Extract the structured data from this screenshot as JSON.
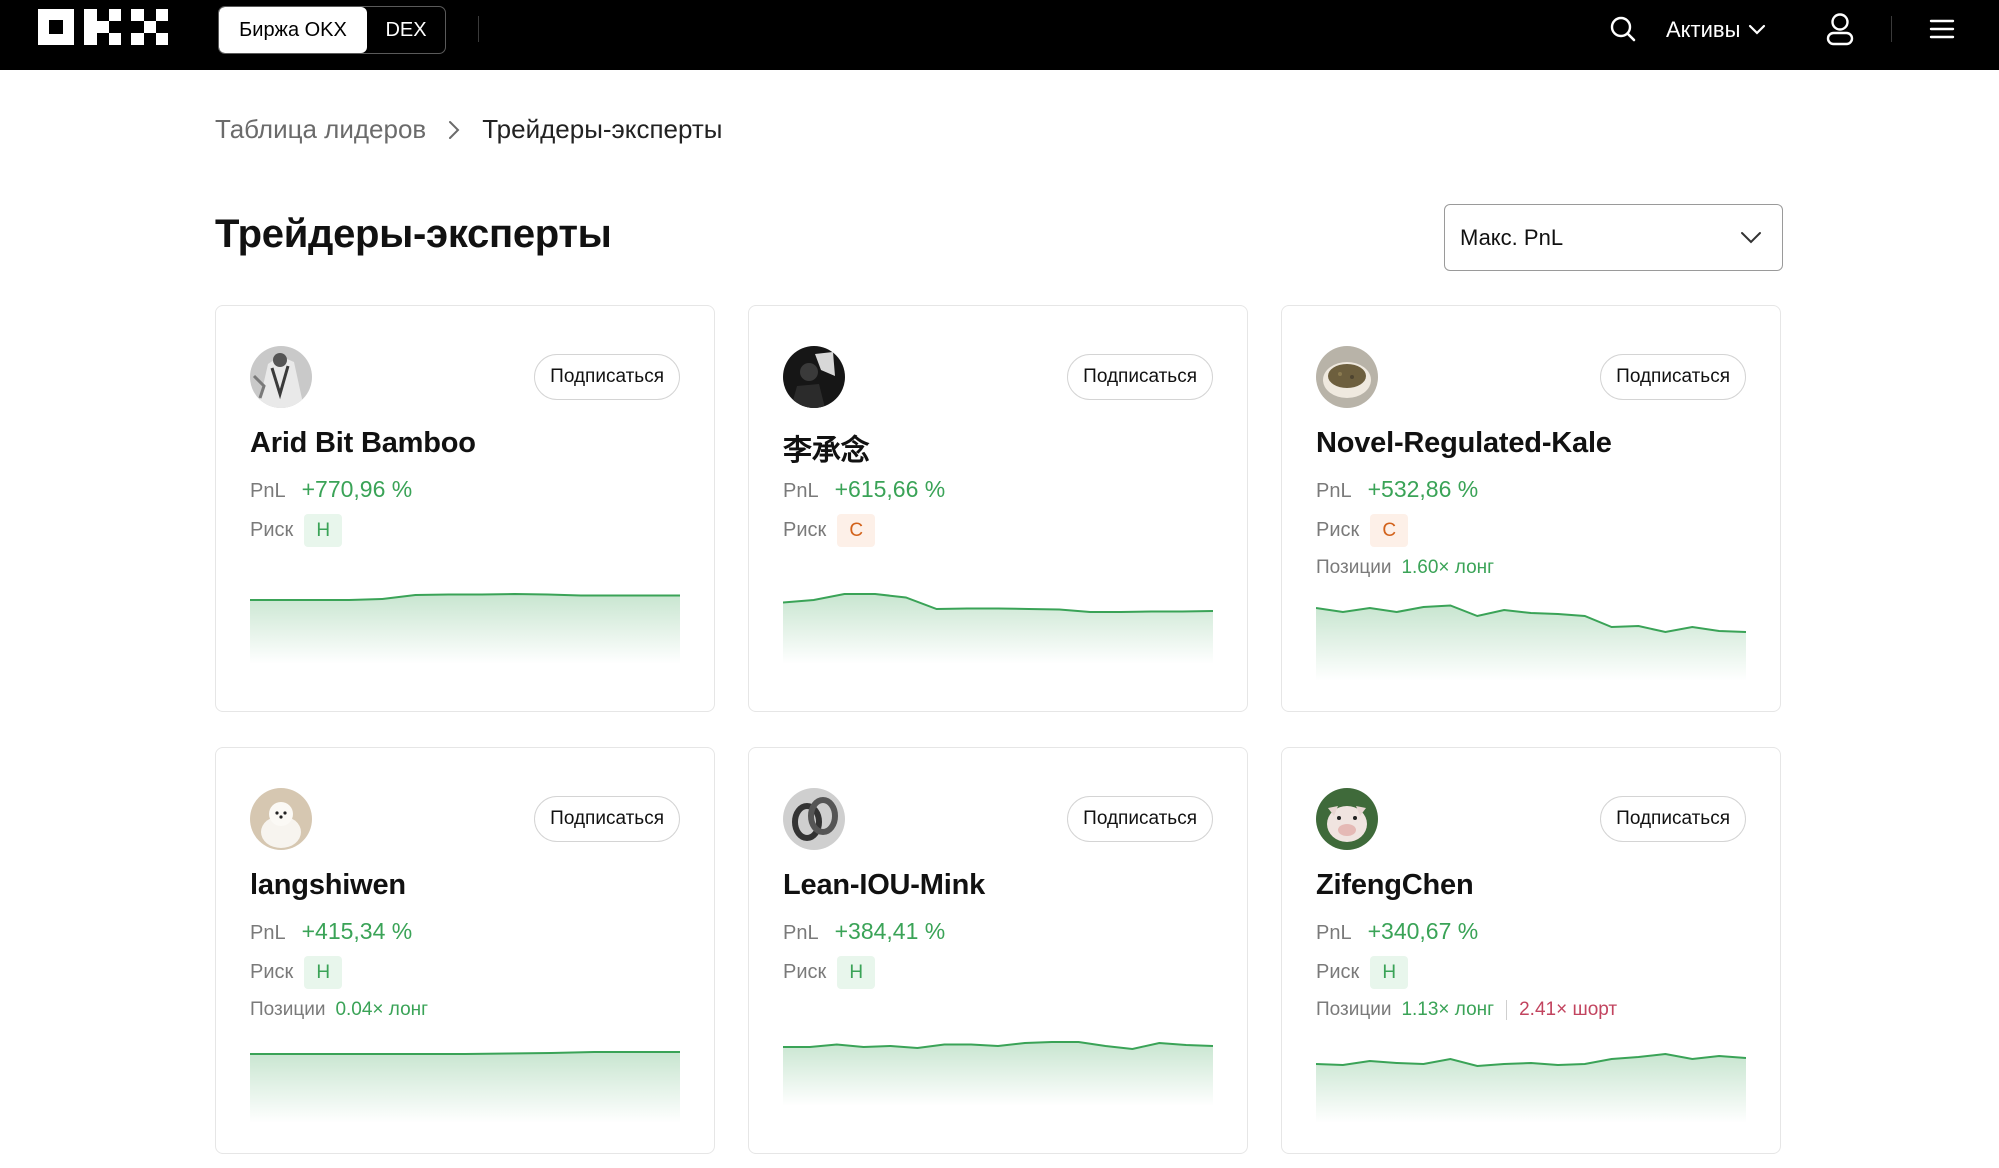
{
  "header": {
    "logo": "OKX",
    "switch": {
      "exchange_label": "Биржа OKX",
      "dex_label": "DEX"
    },
    "assets_label": "Активы",
    "icons": [
      "search-icon",
      "chevron-down-icon",
      "user-icon",
      "menu-icon"
    ]
  },
  "breadcrumb": {
    "parent": "Таблица лидеров",
    "current": "Трейдеры-эксперты"
  },
  "page": {
    "title": "Трейдеры-эксперты"
  },
  "sort": {
    "selected": "Макс. PnL"
  },
  "labels": {
    "pnl": "PnL",
    "risk": "Риск",
    "positions": "Позиции",
    "follow": "Подписаться"
  },
  "colors": {
    "positive": "#3aa357",
    "short": "#c2445f",
    "risk_high_bg": "#e8f6ec",
    "risk_medium_bg": "#fdf0e8",
    "risk_medium_text": "#d2621b"
  },
  "traders": [
    {
      "name": "Arid Bit Bamboo",
      "pnl": "+770,96 %",
      "risk": "Н",
      "risk_level": "low",
      "positions": null,
      "spark": [
        0.6,
        0.6,
        0.6,
        0.6,
        0.62,
        0.7,
        0.71,
        0.71,
        0.72,
        0.71,
        0.69,
        0.69,
        0.69,
        0.69
      ]
    },
    {
      "name": "李承念",
      "pnl": "+615,66 %",
      "risk": "С",
      "risk_level": "medium",
      "positions": null,
      "spark": [
        0.55,
        0.6,
        0.72,
        0.72,
        0.65,
        0.42,
        0.43,
        0.43,
        0.42,
        0.41,
        0.36,
        0.36,
        0.37,
        0.37,
        0.38
      ]
    },
    {
      "name": "Novel-Regulated-Kale",
      "pnl": "+532,86 %",
      "risk": "С",
      "risk_level": "medium",
      "positions": {
        "long": "1.60× лонг",
        "short": null
      },
      "spark": [
        0.78,
        0.7,
        0.78,
        0.7,
        0.8,
        0.83,
        0.62,
        0.74,
        0.68,
        0.66,
        0.62,
        0.4,
        0.42,
        0.3,
        0.4,
        0.32,
        0.3
      ]
    },
    {
      "name": "langshiwen",
      "pnl": "+415,34 %",
      "risk": "Н",
      "risk_level": "low",
      "positions": {
        "long": "0.04× лонг",
        "short": null
      },
      "spark": [
        0.7,
        0.7,
        0.7,
        0.7,
        0.7,
        0.7,
        0.71,
        0.72,
        0.74,
        0.74,
        0.74
      ]
    },
    {
      "name": "Lean-IOU-Mink",
      "pnl": "+384,41 %",
      "risk": "Н",
      "risk_level": "low",
      "positions": null,
      "spark": [
        0.5,
        0.5,
        0.55,
        0.5,
        0.52,
        0.48,
        0.55,
        0.55,
        0.52,
        0.58,
        0.6,
        0.6,
        0.52,
        0.46,
        0.58,
        0.54,
        0.52
      ]
    },
    {
      "name": "ZifengChen",
      "pnl": "+340,67 %",
      "risk": "Н",
      "risk_level": "low",
      "positions": {
        "long": "1.13× лонг",
        "short": "2.41× шорт"
      },
      "spark": [
        0.5,
        0.48,
        0.56,
        0.52,
        0.5,
        0.6,
        0.46,
        0.5,
        0.52,
        0.48,
        0.5,
        0.6,
        0.64,
        0.7,
        0.6,
        0.66,
        0.62
      ]
    }
  ]
}
